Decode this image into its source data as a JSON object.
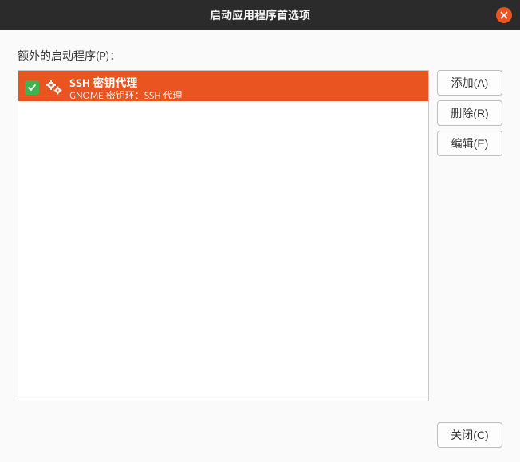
{
  "window": {
    "title": "启动应用程序首选项"
  },
  "label": "额外的启动程序(P)：",
  "items": [
    {
      "checked": true,
      "title": "SSH 密钥代理",
      "subtitle": "GNOME 密钥环：SSH 代理"
    }
  ],
  "buttons": {
    "add": "添加(A)",
    "remove": "删除(R)",
    "edit": "编辑(E)",
    "close": "关闭(C)"
  }
}
